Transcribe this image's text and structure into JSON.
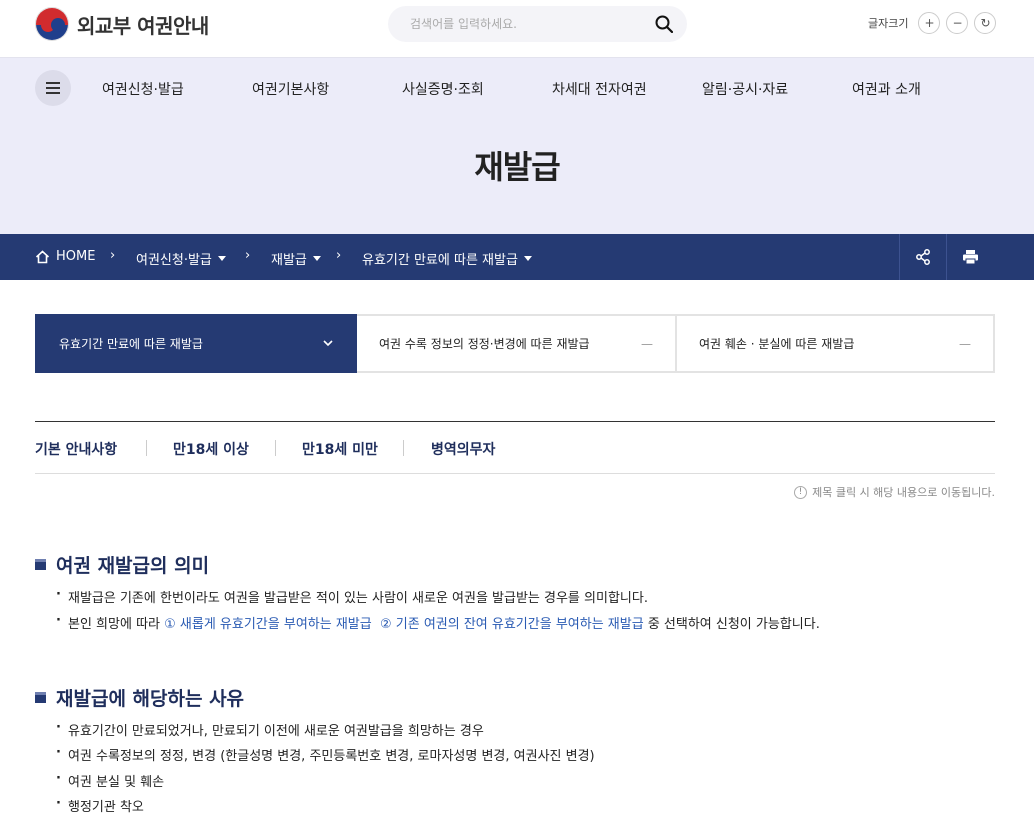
{
  "header": {
    "logo_text": "외교부 여권안내",
    "search_placeholder": "검색어를 입력하세요.",
    "fontsize_label": "글자크기",
    "fontsize_plus": "+",
    "fontsize_minus": "−",
    "fontsize_reset": "↻"
  },
  "gnb": {
    "items": [
      "여권신청·발급",
      "여권기본사항",
      "사실증명·조회",
      "차세대 전자여권",
      "알림·공시·자료",
      "여권과 소개"
    ]
  },
  "page_title": "재발급",
  "breadcrumb": {
    "home": "HOME",
    "items": [
      "여권신청·발급",
      "재발급",
      "유효기간 만료에 따른 재발급"
    ]
  },
  "tabs": [
    {
      "label": "유효기간 만료에 따른 재발급",
      "active": true
    },
    {
      "label": "여권 수록 정보의 정정·변경에 따른 재발급",
      "active": false
    },
    {
      "label": "여권 훼손 · 분실에 따른 재발급",
      "active": false
    }
  ],
  "subnav": [
    "기본 안내사항",
    "만18세 이상",
    "만18세 미만",
    "병역의무자"
  ],
  "note": "제목 클릭 시 해당 내용으로 이동됩니다.",
  "sections": [
    {
      "title": "여권 재발급의 의미",
      "items": [
        "재발급은 기존에 한번이라도 여권을 발급받은 적이 있는 사람이 새로운 여권을 발급받는 경우를 의미합니다.",
        {
          "prefix": "본인 희망에 따라 ",
          "hl1": "① 새롭게 유효기간을 부여하는 재발급",
          "hl2": "② 기존 여권의 잔여 유효기간을 부여하는 재발급",
          "suffix": " 중 선택하여 신청이 가능합니다."
        }
      ]
    },
    {
      "title": "재발급에 해당하는 사유",
      "items": [
        "유효기간이 만료되었거나, 만료되기 이전에 새로운 여권발급을 희망하는 경우",
        "여권 수록정보의 정정, 변경 (한글성명 변경, 주민등록번호 변경, 로마자성명 변경, 여권사진 변경)",
        "여권 분실 및 훼손",
        "행정기관 착오"
      ]
    }
  ]
}
